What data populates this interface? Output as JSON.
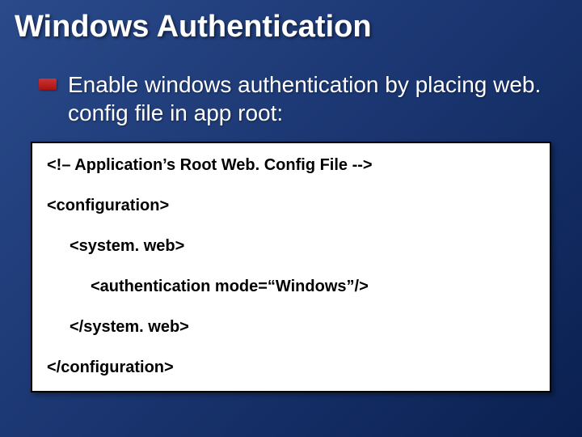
{
  "title": "Windows Authentication",
  "bullet": "Enable windows authentication by placing web. config file in app root:",
  "code": {
    "l1": "<!– Application’s Root Web. Config File -->",
    "l2": "<configuration>",
    "l3": "<system. web>",
    "l4": "<authentication mode=“Windows”/>",
    "l5": "</system. web>",
    "l6": "</configuration>"
  }
}
